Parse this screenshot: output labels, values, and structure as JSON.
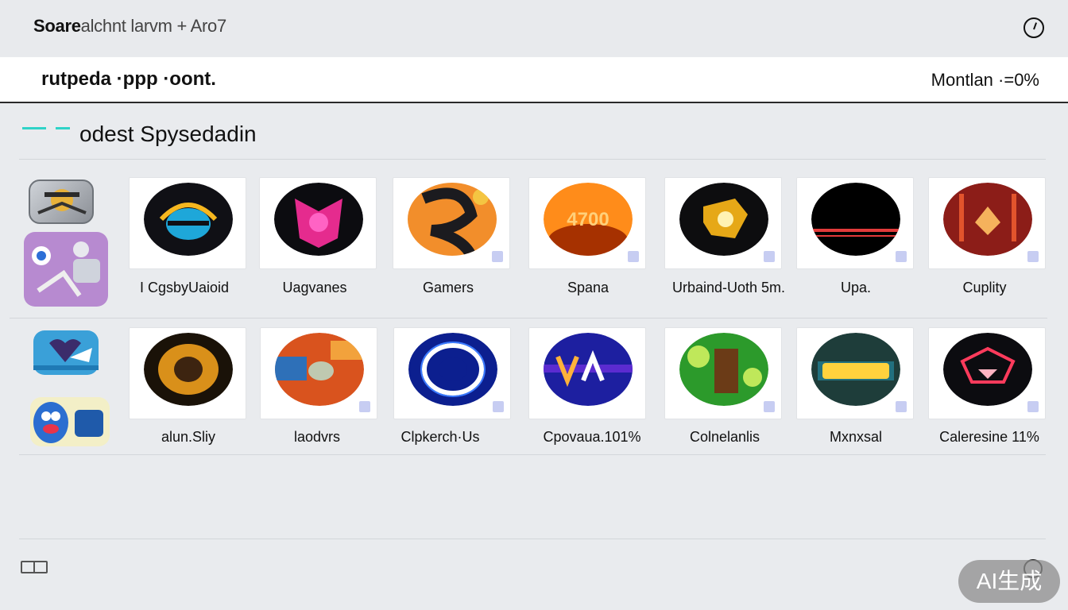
{
  "window": {
    "title_bold": "Soare",
    "title_rest": "alchnt larvm + Aro7"
  },
  "search": {
    "query": "rutpeda ·ppp ·oont.",
    "meta": "Montlan ·=0%"
  },
  "section": {
    "heading": "odest Spysedadin"
  },
  "rows": [
    {
      "items": [
        {
          "label": "I CgsbyUaioid",
          "icon": "shield-helmet-icon",
          "colors": [
            "#101015",
            "#1ea7d9",
            "#f6b71f"
          ]
        },
        {
          "label": "Uagvanes",
          "icon": "pink-creature-icon",
          "colors": [
            "#0c0c10",
            "#e52b8e",
            "#ff63c4"
          ]
        },
        {
          "label": "Gamers",
          "icon": "orange-swirl-icon",
          "colors": [
            "#f28e2b",
            "#1b1b1f",
            "#f4c542"
          ]
        },
        {
          "label": "Spana",
          "icon": "orange-badge-icon",
          "colors": [
            "#ff8c1a",
            "#a63100",
            "#ffd07a"
          ]
        },
        {
          "label": "Urbaind-Uoth 5m.",
          "icon": "gold-emblem-icon",
          "colors": [
            "#0d0d0f",
            "#e6a817",
            "#fff2b3"
          ]
        },
        {
          "label": "Upa.",
          "icon": "black-red-stripe-icon",
          "colors": [
            "#000000",
            "#e23a3a",
            "#2a0000"
          ]
        },
        {
          "label": "Cuplity",
          "icon": "red-forest-icon",
          "colors": [
            "#8c1d18",
            "#e2542c",
            "#f5b25c"
          ]
        }
      ]
    },
    {
      "items": [
        {
          "label": "alun.Sliy",
          "icon": "gold-ring-icon",
          "colors": [
            "#1a1208",
            "#d9901a",
            "#3d2410"
          ]
        },
        {
          "label": "laodvrs",
          "icon": "patchwork-icon",
          "colors": [
            "#d9531e",
            "#2e70b8",
            "#f2a23c"
          ]
        },
        {
          "label": "Clpkerch·Us",
          "icon": "blue-target-icon",
          "colors": [
            "#0c1f8f",
            "#ffffff",
            "#3b7bff"
          ]
        },
        {
          "label": "Cpovaua.101%",
          "icon": "valpha-logo-icon",
          "colors": [
            "#1d1fa0",
            "#ffb23a",
            "#5b2bd0"
          ]
        },
        {
          "label": "Colnelanlis",
          "icon": "green-village-icon",
          "colors": [
            "#2c9a2b",
            "#6b3b17",
            "#bfe85a"
          ]
        },
        {
          "label": "Mxnxsal",
          "icon": "neon-text-icon",
          "colors": [
            "#1e3d3a",
            "#ffd23d",
            "#2bd0ff"
          ]
        },
        {
          "label": "Caleresine  11%",
          "icon": "neon-mask-icon",
          "colors": [
            "#0c0c10",
            "#ff3b5c",
            "#ffb3c2"
          ]
        }
      ]
    }
  ],
  "footer": {
    "badge": "AI生成"
  }
}
